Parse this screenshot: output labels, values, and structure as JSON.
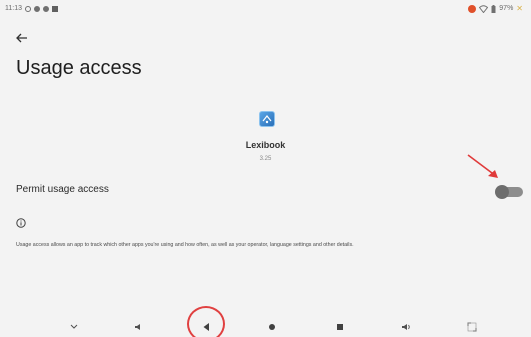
{
  "status_bar": {
    "time": "11:13",
    "battery": "97%",
    "left_icons": [
      "settings-icon",
      "notification-icon",
      "notification-icon",
      "image-icon"
    ],
    "right_icons": [
      "record-icon",
      "wifi-icon",
      "battery-icon",
      "charging-icon"
    ]
  },
  "header": {
    "back_icon": "back-arrow-icon",
    "title": "Usage access"
  },
  "app": {
    "icon": "lexibook-app-icon",
    "name": "Lexibook",
    "version": "3.25"
  },
  "permit": {
    "label": "Permit usage access",
    "enabled": false
  },
  "info": {
    "icon": "info-icon",
    "text": "Usage access allows an app to track which other apps you're using and how often, as well as your operator, language settings and other details."
  },
  "annotations": {
    "arrow_color": "#e03a3a",
    "circle_color": "#e04040"
  },
  "nav_bar": {
    "buttons": [
      "chevron-down-icon",
      "volume-down-icon",
      "back-triangle-icon",
      "home-dot-icon",
      "recents-square-icon",
      "volume-up-icon",
      "screenshot-icon"
    ]
  },
  "colors": {
    "background": "#f3f3f3",
    "toggle_track": "#8d8d8d",
    "toggle_knob": "#6d6d6d"
  }
}
